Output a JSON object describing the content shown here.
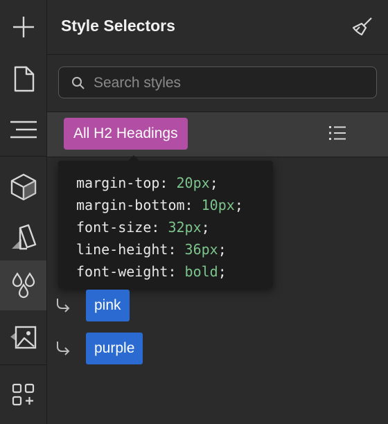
{
  "rail": {
    "items": [
      {
        "icon": "plus-icon"
      },
      {
        "icon": "page-icon"
      },
      {
        "icon": "navigator-icon"
      },
      {
        "icon": "cube-icon"
      },
      {
        "icon": "style-guide-icon"
      },
      {
        "icon": "droplets-icon",
        "active": true
      },
      {
        "icon": "image-icon"
      },
      {
        "icon": "apps-icon"
      }
    ]
  },
  "panel": {
    "title": "Style Selectors",
    "search_placeholder": "Search styles",
    "selected_tag": "All H2 Headings",
    "tooltip": [
      {
        "prop": "margin-top",
        "value": "20px"
      },
      {
        "prop": "margin-bottom",
        "value": "10px"
      },
      {
        "prop": "font-size",
        "value": "32px"
      },
      {
        "prop": "line-height",
        "value": "36px"
      },
      {
        "prop": "font-weight",
        "value": "bold"
      }
    ],
    "children": [
      {
        "label": "pink"
      },
      {
        "label": "purple"
      }
    ]
  },
  "colors": {
    "tag_h2": "#b24ea4",
    "tag_child": "#2b6bd1",
    "css_value": "#7cc58c",
    "background": "#2b2b2b"
  }
}
